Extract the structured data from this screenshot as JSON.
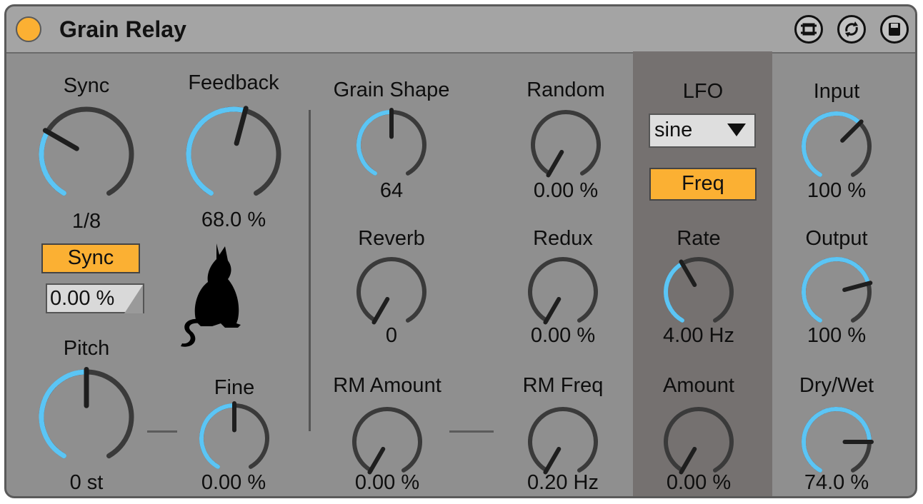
{
  "device": {
    "title": "Grain Relay",
    "power_color": "#fbb033"
  },
  "toolbar": {
    "icons": [
      "hot-swap-icon",
      "refresh-icon",
      "save-icon"
    ]
  },
  "colors": {
    "accent": "#fbb033",
    "arc": "#5bc5f5",
    "track": "#3a3a3a",
    "panel": "#8f8f8f",
    "lfo_panel": "#757170"
  },
  "knobs": {
    "sync": {
      "label": "Sync",
      "value": "1/8",
      "level": 0.3
    },
    "feedback": {
      "label": "Feedback",
      "value": "68.0 %",
      "level": 0.55
    },
    "grain_shape": {
      "label": "Grain Shape",
      "value": "64",
      "level": 0.5
    },
    "random": {
      "label": "Random",
      "value": "0.00 %",
      "level": 0.0
    },
    "reverb": {
      "label": "Reverb",
      "value": "0",
      "level": 0.0
    },
    "redux": {
      "label": "Redux",
      "value": "0.00 %",
      "level": 0.0
    },
    "rm_amount": {
      "label": "RM Amount",
      "value": "0.00 %",
      "level": 0.0
    },
    "rm_freq": {
      "label": "RM Freq",
      "value": "0.20 Hz",
      "level": 0.0
    },
    "rate": {
      "label": "Rate",
      "value": "4.00 Hz",
      "level": 0.4
    },
    "amount": {
      "label": "Amount",
      "value": "0.00 %",
      "level": 0.0
    },
    "input": {
      "label": "Input",
      "value": "100 %",
      "level": 0.65
    },
    "output": {
      "label": "Output",
      "value": "100 %",
      "level": 0.75
    },
    "dry_wet": {
      "label": "Dry/Wet",
      "value": "74.0 %",
      "level": 0.8
    },
    "pitch": {
      "label": "Pitch",
      "value": "0 st",
      "level": 0.5
    },
    "fine": {
      "label": "Fine",
      "value": "0.00 %",
      "level": 0.5
    }
  },
  "sync_button": {
    "label": "Sync",
    "active": true
  },
  "sync_offset": {
    "value": "0.00 %"
  },
  "lfo": {
    "label": "LFO",
    "waveform": "sine",
    "mode_button": "Freq"
  }
}
